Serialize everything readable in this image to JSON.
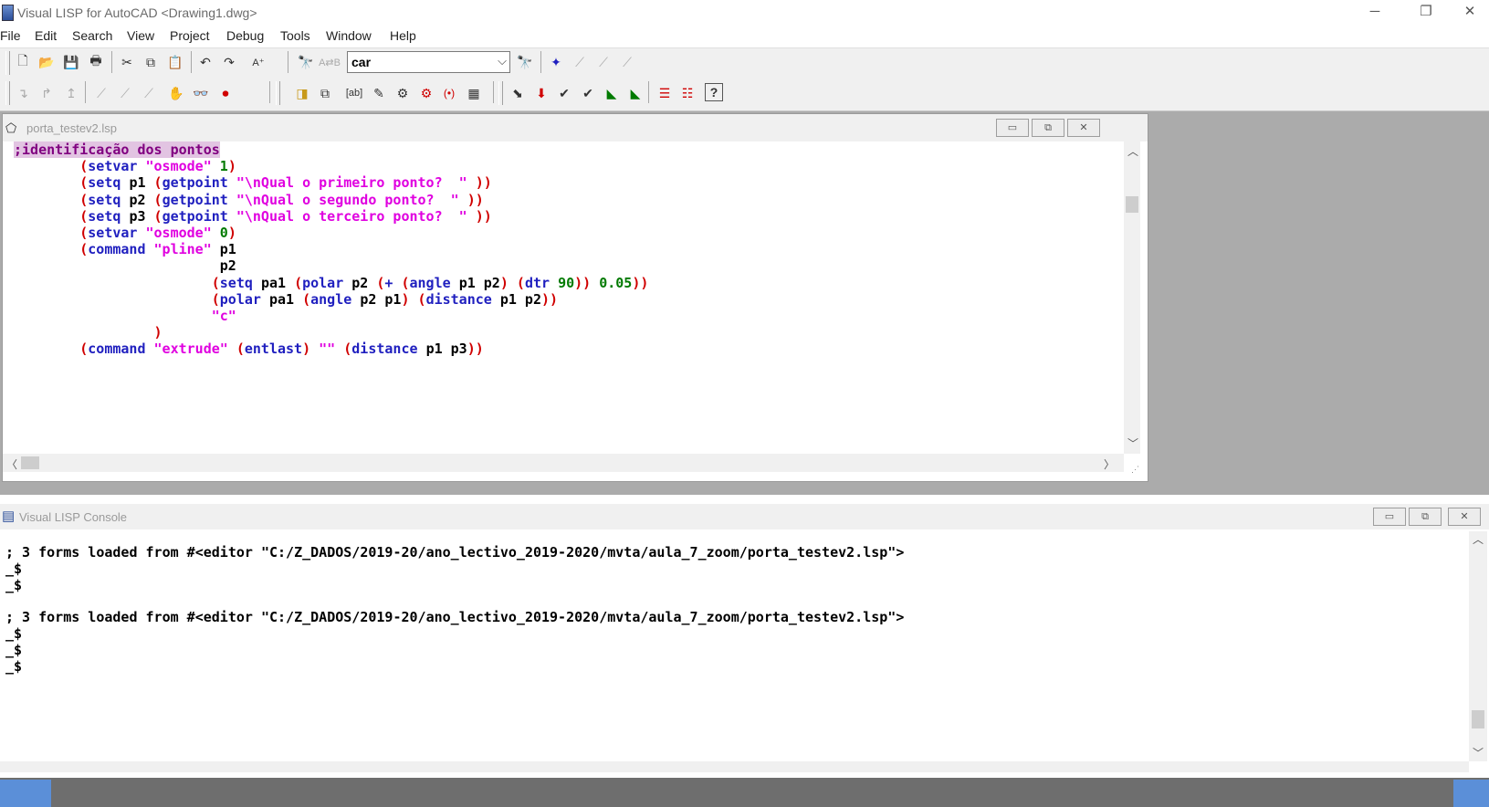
{
  "window": {
    "title": "Visual LISP for AutoCAD <Drawing1.dwg>",
    "minimize": "─",
    "restore": "❐",
    "close": "✕"
  },
  "menu": [
    "File",
    "Edit",
    "Search",
    "View",
    "Project",
    "Debug",
    "Tools",
    "Window",
    "Help"
  ],
  "toolbar": {
    "search_value": "car"
  },
  "editor": {
    "title": "porta_testev2.lsp",
    "lines": [
      [
        {
          "c": "cm",
          "t": ";identificação dos pontos"
        }
      ],
      [
        {
          "c": "v",
          "t": "        "
        },
        {
          "c": "p",
          "t": "("
        },
        {
          "c": "k",
          "t": "setvar "
        },
        {
          "c": "s",
          "t": "\"osmode\" "
        },
        {
          "c": "n",
          "t": "1"
        },
        {
          "c": "p",
          "t": ")"
        }
      ],
      [
        {
          "c": "v",
          "t": "        "
        },
        {
          "c": "p",
          "t": "("
        },
        {
          "c": "k",
          "t": "setq "
        },
        {
          "c": "v",
          "t": "p1 "
        },
        {
          "c": "p",
          "t": "("
        },
        {
          "c": "k",
          "t": "getpoint "
        },
        {
          "c": "s",
          "t": "\"\\nQual o primeiro ponto?  \" "
        },
        {
          "c": "p",
          "t": "))"
        }
      ],
      [
        {
          "c": "v",
          "t": "        "
        },
        {
          "c": "p",
          "t": "("
        },
        {
          "c": "k",
          "t": "setq "
        },
        {
          "c": "v",
          "t": "p2 "
        },
        {
          "c": "p",
          "t": "("
        },
        {
          "c": "k",
          "t": "getpoint "
        },
        {
          "c": "s",
          "t": "\"\\nQual o segundo ponto?  \" "
        },
        {
          "c": "p",
          "t": "))"
        }
      ],
      [
        {
          "c": "v",
          "t": "        "
        },
        {
          "c": "p",
          "t": "("
        },
        {
          "c": "k",
          "t": "setq "
        },
        {
          "c": "v",
          "t": "p3 "
        },
        {
          "c": "p",
          "t": "("
        },
        {
          "c": "k",
          "t": "getpoint "
        },
        {
          "c": "s",
          "t": "\"\\nQual o terceiro ponto?  \" "
        },
        {
          "c": "p",
          "t": "))"
        }
      ],
      [
        {
          "c": "v",
          "t": "        "
        },
        {
          "c": "p",
          "t": "("
        },
        {
          "c": "k",
          "t": "setvar "
        },
        {
          "c": "s",
          "t": "\"osmode\" "
        },
        {
          "c": "n",
          "t": "0"
        },
        {
          "c": "p",
          "t": ")"
        }
      ],
      [
        {
          "c": "v",
          "t": "        "
        },
        {
          "c": "p",
          "t": "("
        },
        {
          "c": "k",
          "t": "command "
        },
        {
          "c": "s",
          "t": "\"pline\" "
        },
        {
          "c": "v",
          "t": "p1"
        }
      ],
      [
        {
          "c": "v",
          "t": "                         p2"
        }
      ],
      [
        {
          "c": "v",
          "t": "                        "
        },
        {
          "c": "p",
          "t": "("
        },
        {
          "c": "k",
          "t": "setq "
        },
        {
          "c": "v",
          "t": "pa1 "
        },
        {
          "c": "p",
          "t": "("
        },
        {
          "c": "k",
          "t": "polar "
        },
        {
          "c": "v",
          "t": "p2 "
        },
        {
          "c": "p",
          "t": "("
        },
        {
          "c": "k",
          "t": "+ "
        },
        {
          "c": "p",
          "t": "("
        },
        {
          "c": "k",
          "t": "angle "
        },
        {
          "c": "v",
          "t": "p1 p2"
        },
        {
          "c": "p",
          "t": ") ("
        },
        {
          "c": "k",
          "t": "dtr "
        },
        {
          "c": "n",
          "t": "90"
        },
        {
          "c": "p",
          "t": ")) "
        },
        {
          "c": "n",
          "t": "0.05"
        },
        {
          "c": "p",
          "t": "))"
        }
      ],
      [
        {
          "c": "v",
          "t": "                        "
        },
        {
          "c": "p",
          "t": "("
        },
        {
          "c": "k",
          "t": "polar "
        },
        {
          "c": "v",
          "t": "pa1 "
        },
        {
          "c": "p",
          "t": "("
        },
        {
          "c": "k",
          "t": "angle "
        },
        {
          "c": "v",
          "t": "p2 p1"
        },
        {
          "c": "p",
          "t": ") ("
        },
        {
          "c": "k",
          "t": "distance "
        },
        {
          "c": "v",
          "t": "p1 p2"
        },
        {
          "c": "p",
          "t": "))"
        }
      ],
      [
        {
          "c": "v",
          "t": "                        "
        },
        {
          "c": "s",
          "t": "\"c\""
        }
      ],
      [
        {
          "c": "v",
          "t": "                 "
        },
        {
          "c": "p",
          "t": ")"
        }
      ],
      [
        {
          "c": "v",
          "t": "        "
        },
        {
          "c": "p",
          "t": "("
        },
        {
          "c": "k",
          "t": "command "
        },
        {
          "c": "s",
          "t": "\"extrude\" "
        },
        {
          "c": "p",
          "t": "("
        },
        {
          "c": "k",
          "t": "entlast"
        },
        {
          "c": "p",
          "t": ") "
        },
        {
          "c": "s",
          "t": "\"\" "
        },
        {
          "c": "p",
          "t": "("
        },
        {
          "c": "k",
          "t": "distance "
        },
        {
          "c": "v",
          "t": "p1 p3"
        },
        {
          "c": "p",
          "t": "))"
        }
      ]
    ]
  },
  "console": {
    "title": "Visual LISP Console",
    "lines": [
      "; 3 forms loaded from #<editor \"C:/Z_DADOS/2019-20/ano_lectivo_2019-2020/mvta/aula_7_zoom/porta_testev2.lsp\">",
      "_$",
      "_$",
      "; 3 forms loaded from #<editor \"C:/Z_DADOS/2019-20/ano_lectivo_2019-2020/mvta/aula_7_zoom/porta_testev2.lsp\">",
      "_$",
      "_$",
      "_$"
    ]
  },
  "colors": {
    "comment": "#800080",
    "paren": "#d00000",
    "keyword": "#1f1fbf",
    "string": "#e000e0",
    "number": "#007a00"
  }
}
